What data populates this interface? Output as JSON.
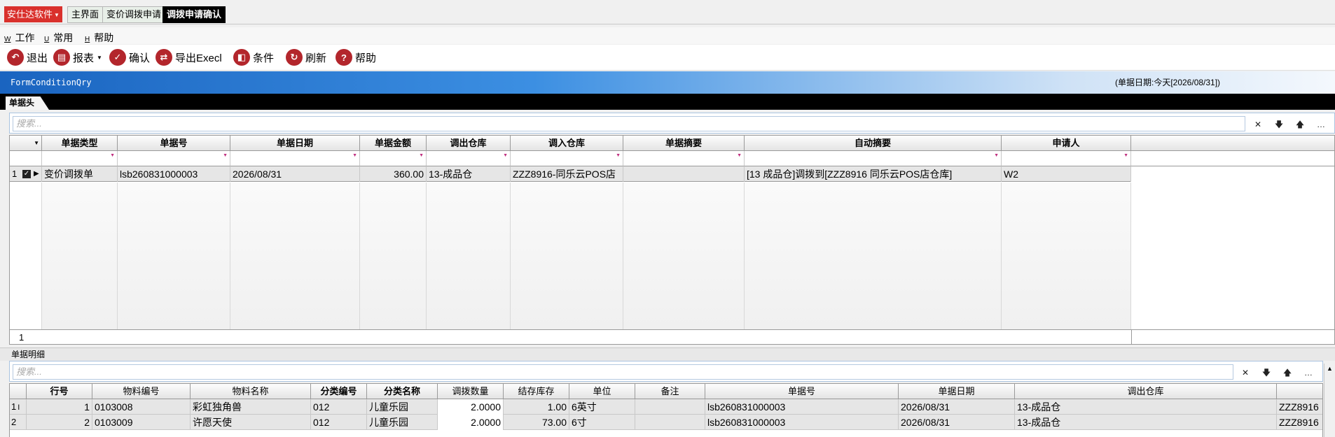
{
  "tabs": {
    "brand": "安仕达软件",
    "items": [
      {
        "label": "主界面"
      },
      {
        "label": "变价调拨申请"
      },
      {
        "label": "调拨申请确认"
      }
    ]
  },
  "menu": [
    {
      "acc": "W",
      "label": "工作"
    },
    {
      "acc": "U",
      "label": "常用"
    },
    {
      "acc": "H",
      "label": "帮助"
    }
  ],
  "toolbar": [
    {
      "label": "退出",
      "icon": "exit-icon"
    },
    {
      "label": "报表",
      "icon": "printer-icon"
    },
    {
      "label": "确认",
      "icon": "check-icon"
    },
    {
      "label": "导出Execl",
      "icon": "export-icon"
    },
    {
      "label": "条件",
      "icon": "filter-icon"
    },
    {
      "label": "刷新",
      "icon": "refresh-icon"
    },
    {
      "label": "帮助",
      "icon": "help-icon"
    }
  ],
  "banner": {
    "title": "FormConditionQry",
    "date_text": "(单据日期:今天[2026/08/31])"
  },
  "head_section": {
    "tab_label": "单据头",
    "search_placeholder": "搜索...",
    "columns": [
      "单据类型",
      "单据号",
      "单据日期",
      "单据金额",
      "调出仓库",
      "调入仓库",
      "单据摘要",
      "自动摘要",
      "申请人"
    ],
    "rows": [
      {
        "index": "1",
        "type": "变价调拨单",
        "no": "lsb260831000003",
        "date": "2026/08/31",
        "amount": "360.00",
        "out_wh": "13-成品仓",
        "in_wh": "ZZZ8916-同乐云POS店",
        "summary": "",
        "auto_summary": "[13 成品仓]调拨到[ZZZ8916 同乐云POS店仓库]",
        "applicant": "W2"
      }
    ],
    "footer_count": "1"
  },
  "detail_section": {
    "label": "单据明细",
    "search_placeholder": "搜索...",
    "columns": [
      "行号",
      "物料编号",
      "物料名称",
      "分类编号",
      "分类名称",
      "调拨数量",
      "结存库存",
      "单位",
      "备注",
      "单据号",
      "单据日期",
      "调出仓库"
    ],
    "rows": [
      {
        "index": "1",
        "line": "1",
        "code": "0103008",
        "name": "彩虹独角兽",
        "cat_code": "012",
        "cat_name": "儿童乐园",
        "qty": "2.0000",
        "stock": "1.00",
        "unit": "6英寸",
        "note": "",
        "no": "lsb260831000003",
        "date": "2026/08/31",
        "out_wh": "13-成品仓",
        "overflow": "ZZZ8916"
      },
      {
        "index": "2",
        "line": "2",
        "code": "0103009",
        "name": "许愿天使",
        "cat_code": "012",
        "cat_name": "儿童乐园",
        "qty": "2.0000",
        "stock": "73.00",
        "unit": "6寸",
        "note": "",
        "no": "lsb260831000003",
        "date": "2026/08/31",
        "out_wh": "13-成品仓",
        "overflow": "ZZZ8916"
      }
    ]
  },
  "colors": {
    "brand": "#d9302c",
    "accent": "#1a64c0",
    "icon": "#b3262c"
  }
}
